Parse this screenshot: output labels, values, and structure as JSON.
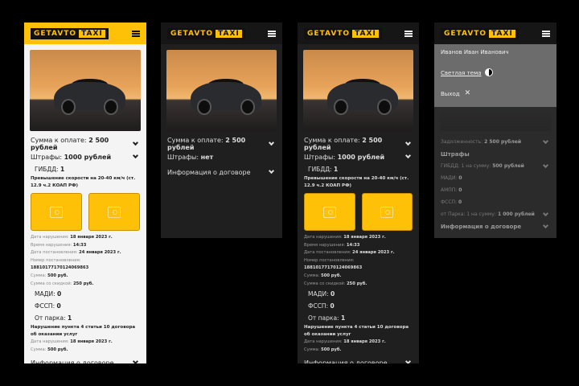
{
  "logo": {
    "part1": "GETAVTO",
    "part2": "TAXI"
  },
  "summary": {
    "label": "Сумма к оплате:",
    "value": "2 500 рублей"
  },
  "fines": {
    "label": "Штрафы:",
    "value": "1000 рублей",
    "none": "нет"
  },
  "gibdd": {
    "label": "ГИБДД:",
    "value": "1",
    "desc": "Превышение скорости на 20-40 км/ч (ст. 12.9 ч.2 КОАП РФ)",
    "details": [
      {
        "k": "Дата нарушения:",
        "v": "18 января 2023 г."
      },
      {
        "k": "Время нарушения:",
        "v": "14:33"
      },
      {
        "k": "Дата постановления:",
        "v": "24 января 2023 г."
      },
      {
        "k": "Номер постановления:",
        "v": "18810177170124069863"
      },
      {
        "k": "Сумма:",
        "v": "500 руб."
      },
      {
        "k": "Сумма со скидкой:",
        "v": "250 руб."
      }
    ]
  },
  "madi": {
    "label": "МАДИ:",
    "value": "0"
  },
  "fssp": {
    "label": "ФССП:",
    "value": "0"
  },
  "park": {
    "label": "От парка:",
    "value": "1",
    "desc": "Нарушение пункта 4 статьи 10 договора об оказании услуг",
    "details": [
      {
        "k": "Дата нарушения:",
        "v": "18 января 2023 г."
      },
      {
        "k": "Сумма:",
        "v": "500 руб."
      }
    ]
  },
  "contract": "Информация о договоре",
  "menu": {
    "user": "Иванов Иван Иванович",
    "theme": "Светлая тема",
    "logout": "Выход"
  },
  "collapsed": {
    "debt": {
      "k": "Задолженность:",
      "v": "2 500 рублей"
    },
    "fines": "Штрафы",
    "gibdd": {
      "k": "ГИБДД: 1 на сумму:",
      "v": "500 рублей"
    },
    "madi": {
      "k": "МАДИ:",
      "v": "0"
    },
    "ampp": {
      "k": "АМПП:",
      "v": "0"
    },
    "fssp": {
      "k": "ФССП:",
      "v": "0"
    },
    "park": {
      "k": "от Парка: 1 на сумму:",
      "v": "1 000 рублей"
    },
    "contract": "Информация о договоре"
  }
}
